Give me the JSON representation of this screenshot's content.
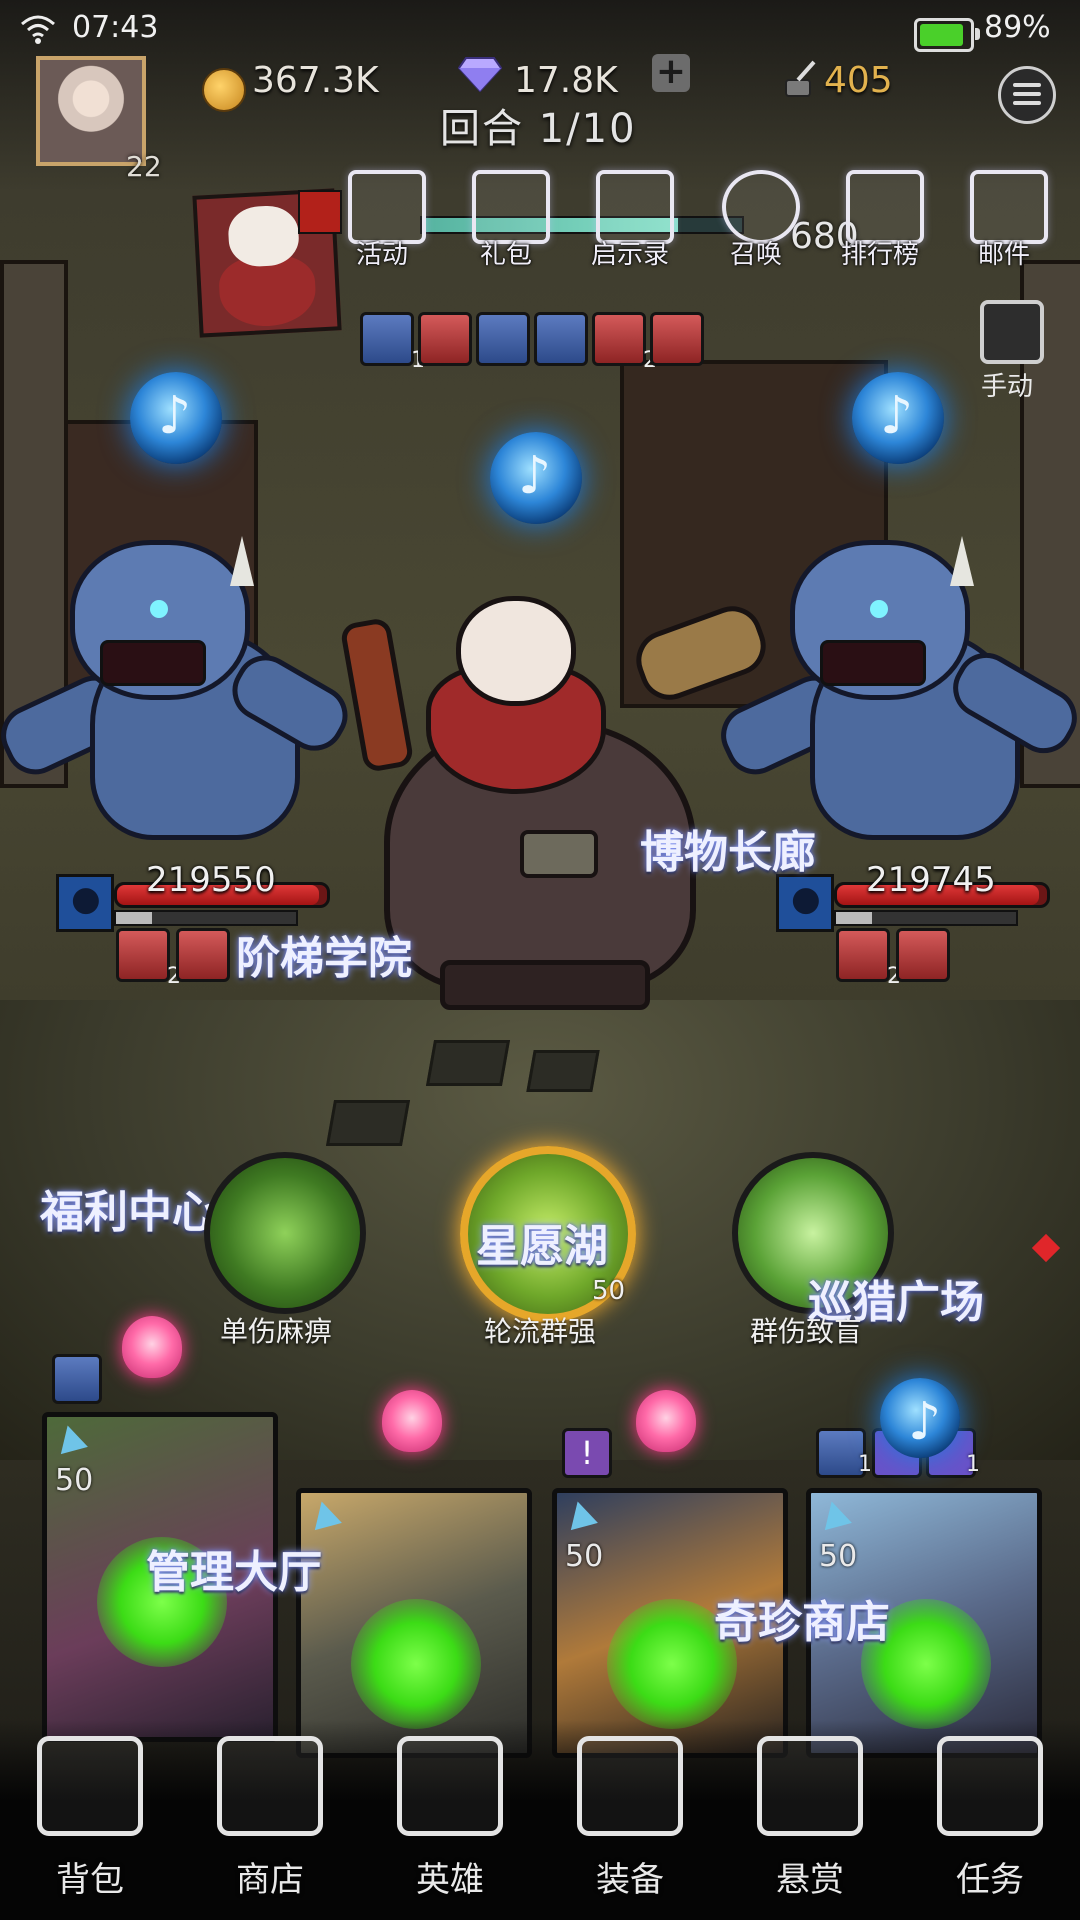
{
  "status_bar": {
    "time": "07:43",
    "battery_pct": "89%",
    "battery_level": 0.89
  },
  "player": {
    "level": "22"
  },
  "currencies": {
    "gold": "367.3K",
    "diamonds": "17.8K",
    "ink": "405"
  },
  "battle": {
    "round": "回合 1/10",
    "energy_value": "680",
    "energy_level": 0.8
  },
  "top_menu": [
    {
      "label": "活动",
      "icon": "tent-icon"
    },
    {
      "label": "礼包",
      "icon": "gift-icon"
    },
    {
      "label": "启示录",
      "icon": "book-icon"
    },
    {
      "label": "召唤",
      "icon": "cards-icon"
    },
    {
      "label": "排行榜",
      "icon": "rank-icon"
    },
    {
      "label": "邮件",
      "icon": "mail-icon"
    }
  ],
  "buffs": [
    {
      "icon": "shield-icon",
      "count": "1",
      "color": "blue"
    },
    {
      "icon": "fire-drop-icon",
      "count": "",
      "color": "red"
    },
    {
      "icon": "up-arrow-icon",
      "count": "",
      "color": "blue"
    },
    {
      "icon": "trident-icon",
      "count": "",
      "color": "blue"
    },
    {
      "icon": "fire-drop-icon",
      "count": "2",
      "color": "red"
    },
    {
      "icon": "sword-icon",
      "count": "",
      "color": "red"
    }
  ],
  "manual_mode": {
    "label": "手动"
  },
  "enemies": [
    {
      "hp": "219550",
      "debuff_count": "2"
    },
    {
      "hp": "219745",
      "debuff_count": "2"
    }
  ],
  "floating_labels": {
    "museum": "博物长廊",
    "academy": "阶梯学院",
    "welfare": "福利中心",
    "wish_lake": "星愿湖",
    "hunt_square": "巡猎广场",
    "management": "管理大厅",
    "shop": "奇珍商店"
  },
  "skills": [
    {
      "label": "单伤麻痹",
      "level": ""
    },
    {
      "label": "轮流群强",
      "level": "50"
    },
    {
      "label": "群伤致盲",
      "level": ""
    }
  ],
  "heroes": [
    {
      "level": "50"
    },
    {
      "level": ""
    },
    {
      "level": "50"
    },
    {
      "level": "50"
    }
  ],
  "hero_badges": {
    "card4_count1": "1",
    "card4_count2": "1"
  },
  "bottom_nav": [
    {
      "label": "背包",
      "icon": "backpack-icon"
    },
    {
      "label": "商店",
      "icon": "shop-icon"
    },
    {
      "label": "英雄",
      "icon": "hero-icon"
    },
    {
      "label": "装备",
      "icon": "anvil-icon"
    },
    {
      "label": "悬赏",
      "icon": "bounty-icon"
    },
    {
      "label": "任务",
      "icon": "scroll-icon"
    }
  ],
  "colors": {
    "hp_red": "#e03838",
    "energy_teal": "#56b3a0",
    "gold_text": "#e2b24e",
    "glow_green": "#3cdc16"
  }
}
